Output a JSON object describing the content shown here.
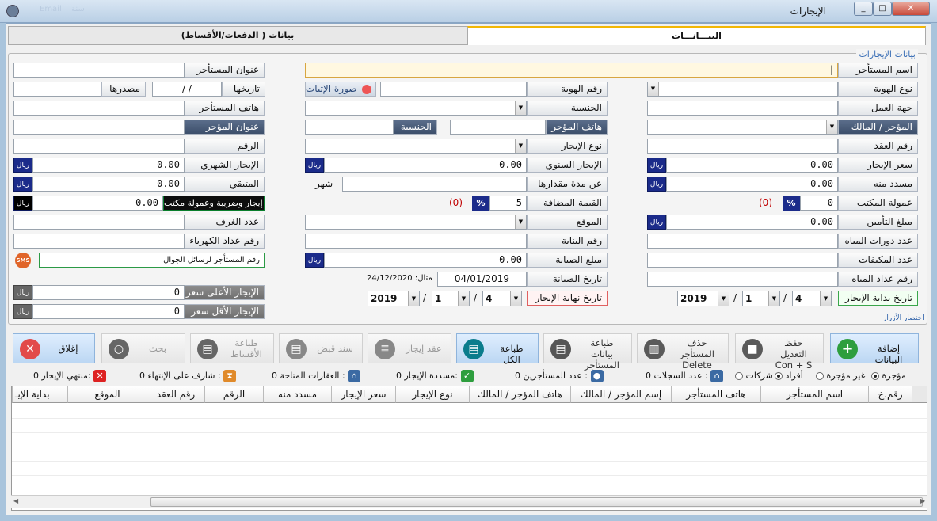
{
  "window": {
    "title": "الإيجارات",
    "menu_faint": [
      "Email",
      "سنة"
    ],
    "controls": [
      "_",
      "□",
      "✕"
    ]
  },
  "tabs": [
    {
      "label": "البيـــانـــات",
      "active": true
    },
    {
      "label": "بيانات ( الدفعات/الأقساط)",
      "active": false
    }
  ],
  "group_label": "بيانات الإيجارات",
  "currency": "ريال",
  "fields": {
    "tenant_name": {
      "label": "اسم المستأجر",
      "value": "|"
    },
    "tenant_address": {
      "label": "عنوان المستأجر",
      "value": ""
    },
    "id_type": {
      "label": "نوع الهوية",
      "value": ""
    },
    "id_number": {
      "label": "رقم الهوية",
      "value": ""
    },
    "id_proof": {
      "label": "صورة الإثبات"
    },
    "id_date": {
      "label": "تاريخها",
      "value": "/ /"
    },
    "id_source": {
      "label": "مصدرها",
      "value": ""
    },
    "workplace": {
      "label": "جهة العمل",
      "value": ""
    },
    "nationality": {
      "label": "الجنسية",
      "value": ""
    },
    "tenant_phone": {
      "label": "هاتف المستأجر",
      "value": ""
    },
    "landlord": {
      "label": "المؤجر / المالك",
      "value": ""
    },
    "landlord_phone": {
      "label": "هاتف المؤجر",
      "value": ""
    },
    "landlord_nationality": {
      "label": "الجنسية",
      "value": ""
    },
    "landlord_address": {
      "label": "عنوان المؤجر",
      "value": ""
    },
    "contract_no": {
      "label": "رقم العقد",
      "value": ""
    },
    "rent_type": {
      "label": "نوع الإيجار",
      "value": ""
    },
    "number": {
      "label": "الرقم",
      "value": ""
    },
    "rent_price": {
      "label": "سعر الإيجار",
      "value": "0.00"
    },
    "annual_rent": {
      "label": "الإيجار السنوي",
      "value": "0.00"
    },
    "monthly_rent": {
      "label": "الإيجار الشهري",
      "value": "0.00"
    },
    "paid": {
      "label": "مسدد منه",
      "value": "0.00"
    },
    "period": {
      "label": "عن مدة مقدارها",
      "value": "",
      "unit": "شهر"
    },
    "remaining": {
      "label": "المتبقي",
      "value": "0.00"
    },
    "office_commission": {
      "label": "عمولة المكتب",
      "value": "0",
      "pct": "%",
      "extra": "(0)"
    },
    "vat": {
      "label": "القيمة المضافة",
      "value": "5",
      "pct": "%",
      "extra": "(0)"
    },
    "total_rent": {
      "label": "إيجار وضريبة وعمولة مكتب",
      "value": "0.00"
    },
    "insurance": {
      "label": "مبلغ التأمين",
      "value": "0.00"
    },
    "location": {
      "label": "الموقع",
      "value": ""
    },
    "rooms": {
      "label": "عدد الغرف",
      "value": ""
    },
    "bathrooms": {
      "label": "عدد دورات المياه",
      "value": ""
    },
    "building_no": {
      "label": "رقم البناية",
      "value": ""
    },
    "electric_meter": {
      "label": "رقم عداد الكهرباء",
      "value": ""
    },
    "ac_count": {
      "label": "عدد المكيفات",
      "value": ""
    },
    "maintenance_amount": {
      "label": "مبلغ الصيانة",
      "value": "0.00"
    },
    "sms_number": {
      "label": "رقم المستأجر لرسائل الجوال",
      "value": ""
    },
    "water_meter": {
      "label": "رقم عداد المياه",
      "value": ""
    },
    "maintenance_date": {
      "label": "تاريخ الصيانة",
      "value": "04/01/2019",
      "example": "مثال: 24/12/2020"
    },
    "max_rent": {
      "label": "الإيجار الأعلى سعر",
      "value": "0"
    },
    "min_rent": {
      "label": "الإيجار الأقل سعر",
      "value": "0"
    },
    "rent_start": {
      "label": "تاريخ بداية الإيجار",
      "day": "4",
      "month": "1",
      "year": "2019"
    },
    "rent_end": {
      "label": "تاريخ نهاية الإيجار",
      "day": "4",
      "month": "1",
      "year": "2019"
    },
    "shortcuts": "اختصار الأزرار"
  },
  "toolbar": [
    {
      "key": "add",
      "label": "إضافة البيانات",
      "icon": "plus-icon",
      "color": "#2e9e3e"
    },
    {
      "key": "save",
      "label": "حفظ التعديل Con + S",
      "icon": "floppy-icon",
      "color": "#555"
    },
    {
      "key": "delete",
      "label": "حذف المستأجر Delete",
      "icon": "trash-icon",
      "color": "#555"
    },
    {
      "key": "print_tenant",
      "label": "طباعة بيانات المستأجر",
      "icon": "printer-icon",
      "color": "#555"
    },
    {
      "key": "print_all",
      "label": "طباعة الكل",
      "icon": "printer-icon",
      "color": "#0a7c8c"
    },
    {
      "key": "contract",
      "label": "عقد إيجار",
      "icon": "document-icon",
      "color": "#777"
    },
    {
      "key": "receipt",
      "label": "سند قبض",
      "icon": "receipt-icon",
      "color": "#777"
    },
    {
      "key": "print_installments",
      "label": "طباعة الأقساط",
      "icon": "printer-icon",
      "color": "#666"
    },
    {
      "key": "search",
      "label": "بحث",
      "icon": "magnifier-icon",
      "color": "#666"
    },
    {
      "key": "close",
      "label": "إغلاق",
      "icon": "close-icon",
      "color": "#e24a4a"
    }
  ],
  "filters": {
    "rented": "مؤجرة",
    "not_rented": "غير مؤجرة",
    "individuals": "أفراد",
    "companies": "شركات"
  },
  "stats": [
    {
      "label": "عدد السجلات :",
      "value": "0"
    },
    {
      "label": "عدد المستأجرين :",
      "value": "0"
    },
    {
      "label": "مسددة الإيجار:",
      "value": "0"
    },
    {
      "label": "العقارات المتاحة :",
      "value": "0"
    },
    {
      "label": "شارف على الإنتهاء :",
      "value": "0"
    },
    {
      "label": "منتهي الإيجار:",
      "value": "0"
    }
  ],
  "grid_columns": [
    "رقم.خ",
    "اسم المستأجر",
    "هاتف المستأجر",
    "إسم المؤجر / المالك",
    "هاتف المؤجر / المالك",
    "نوع الإيجار",
    "سعر الإيجار",
    "مسدد منه",
    "الرقم",
    "رقم العقد",
    "الموقع",
    "بداية الإيـ"
  ]
}
